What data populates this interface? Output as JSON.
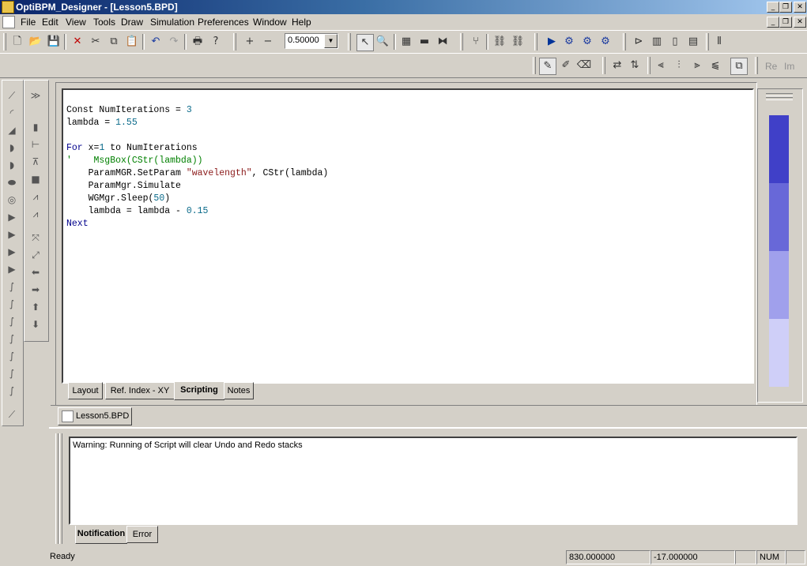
{
  "window": {
    "title": "OptiBPM_Designer - [Lesson5.BPD]",
    "minimize": "_",
    "restore": "❐",
    "close": "✕"
  },
  "menu": [
    "File",
    "Edit",
    "View",
    "Tools",
    "Draw",
    "Simulation",
    "Preferences",
    "Window",
    "Help"
  ],
  "toolbar": {
    "zoom_value": "0.50000",
    "zoom_arrow": "▼",
    "re_label": "Re",
    "im_label": "Im"
  },
  "editor": {
    "code_lines": [
      {
        "parts": [
          {
            "t": "Const NumIterations = ",
            "c": ""
          },
          {
            "t": "3",
            "c": "num"
          }
        ]
      },
      {
        "parts": [
          {
            "t": "lambda = ",
            "c": ""
          },
          {
            "t": "1.55",
            "c": "num"
          }
        ]
      },
      {
        "parts": [
          {
            "t": "",
            "c": ""
          }
        ]
      },
      {
        "parts": [
          {
            "t": "For",
            "c": "kw"
          },
          {
            "t": " x=",
            "c": ""
          },
          {
            "t": "1",
            "c": "num"
          },
          {
            "t": " to NumIterations",
            "c": ""
          }
        ]
      },
      {
        "parts": [
          {
            "t": "'    MsgBox(CStr(lambda))",
            "c": "cmt"
          }
        ]
      },
      {
        "parts": [
          {
            "t": "    ParamMGR.SetParam ",
            "c": ""
          },
          {
            "t": "\"wavelength\"",
            "c": "str"
          },
          {
            "t": ", CStr(lambda)",
            "c": ""
          }
        ]
      },
      {
        "parts": [
          {
            "t": "    ParamMgr.Simulate",
            "c": ""
          }
        ]
      },
      {
        "parts": [
          {
            "t": "    WGMgr.Sleep(",
            "c": ""
          },
          {
            "t": "50",
            "c": "num"
          },
          {
            "t": ")",
            "c": ""
          }
        ]
      },
      {
        "parts": [
          {
            "t": "    lambda = lambda - ",
            "c": ""
          },
          {
            "t": "0.15",
            "c": "num"
          }
        ]
      },
      {
        "parts": [
          {
            "t": "Next",
            "c": "kw"
          }
        ]
      }
    ]
  },
  "view_tabs": {
    "layout": "Layout",
    "refindex": "Ref. Index - XY",
    "scripting": "Scripting",
    "notes": "Notes"
  },
  "doc_tab": "Lesson5.BPD",
  "output": {
    "message": "Warning: Running of Script will clear Undo and Redo stacks",
    "tab_notification": "Notification",
    "tab_error": "Error"
  },
  "statusbar": {
    "ready": "Ready",
    "coord_x": "830.000000",
    "coord_y": "-17.000000",
    "num": "NUM"
  },
  "colors": {
    "title_start": "#0a246a",
    "title_end": "#a6caf0",
    "keyword": "#00008b",
    "number": "#0a6a8a",
    "string": "#8b1a1a",
    "comment": "#008000",
    "palette": [
      "#4040c8",
      "#6868d8",
      "#a0a0ec",
      "#cfcff8"
    ]
  }
}
